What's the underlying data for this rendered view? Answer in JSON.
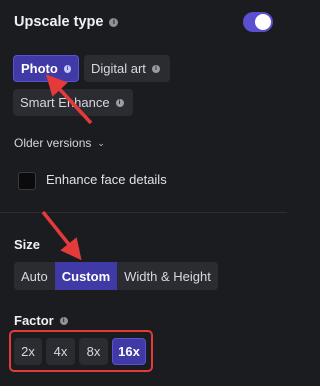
{
  "upscale": {
    "title": "Upscale type",
    "toggle_on": true,
    "types": [
      {
        "label": "Photo",
        "active": true
      },
      {
        "label": "Digital art",
        "active": false
      },
      {
        "label": "Smart Enhance",
        "active": false
      }
    ],
    "older_versions_label": "Older versions",
    "enhance_face_label": "Enhance face details",
    "enhance_face_checked": false
  },
  "size": {
    "label": "Size",
    "options": [
      {
        "label": "Auto",
        "active": false
      },
      {
        "label": "Custom",
        "active": true
      },
      {
        "label": "Width & Height",
        "active": false
      }
    ]
  },
  "factor": {
    "label": "Factor",
    "options": [
      {
        "label": "2x",
        "active": false
      },
      {
        "label": "4x",
        "active": false
      },
      {
        "label": "8x",
        "active": false
      },
      {
        "label": "16x",
        "active": true
      }
    ]
  },
  "colors": {
    "accent": "#3f3aa5",
    "toggle": "#5a4fcf",
    "annotation": "#e33a3a",
    "background": "#1b1c20"
  }
}
